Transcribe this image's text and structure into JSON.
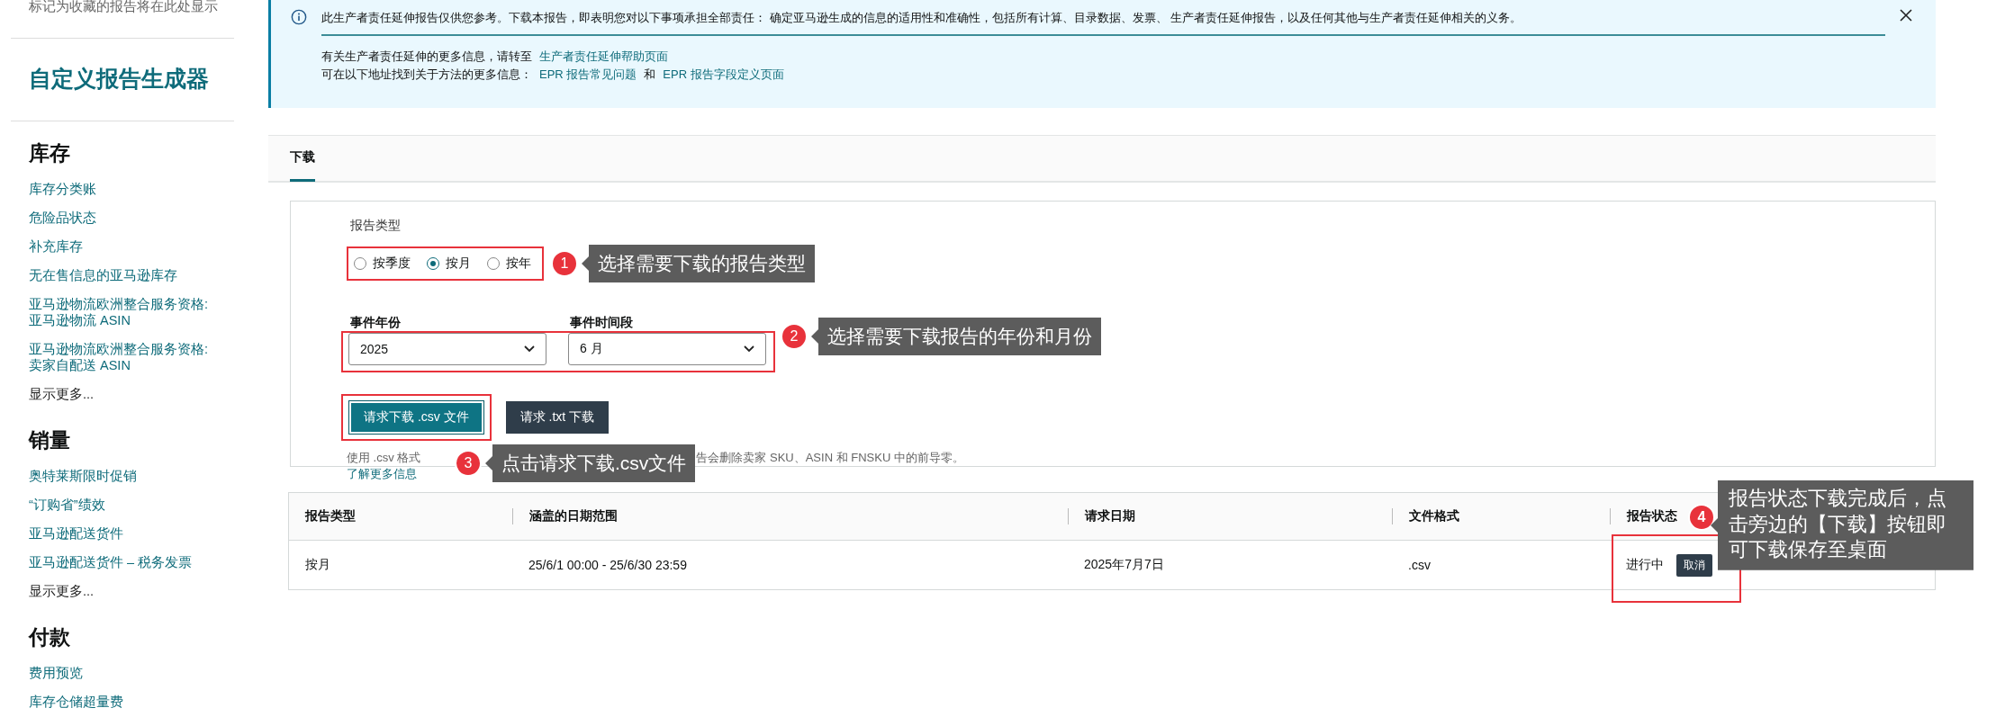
{
  "sidebar": {
    "favorites_note": "标记为收藏的报告将在此处显示",
    "title": "自定义报告生成器",
    "sections": [
      {
        "heading": "库存",
        "items": [
          "库存分类账",
          "危险品状态",
          "补充库存",
          "无在售信息的亚马逊库存",
          "亚马逊物流欧洲整合服务资格:\n亚马逊物流 ASIN",
          "亚马逊物流欧洲整合服务资格:\n卖家自配送 ASIN"
        ],
        "more": "显示更多..."
      },
      {
        "heading": "销量",
        "items": [
          "奥特莱斯限时促销",
          "“订购省”绩效",
          "亚马逊配送货件",
          "亚马逊配送货件 – 税务发票"
        ],
        "more": "显示更多..."
      },
      {
        "heading": "付款",
        "items": [
          "费用预览",
          "库存仓储超量费"
        ]
      }
    ]
  },
  "banner": {
    "message": "此生产者责任延伸报告仅供您参考。下载本报告，即表明您对以下事项承担全部责任： 确定亚马逊生成的信息的适用性和准确性，包括所有计算、目录数据、发票、 生产者责任延伸报告，以及任何其他与生产者责任延伸相关的义务。",
    "help_text": "有关生产者责任延伸的更多信息，请转至",
    "help_link": "生产者责任延伸帮助页面",
    "more_text": "可在以下地址找到关于方法的更多信息：",
    "links": [
      "EPR 报告常见问题",
      "EPR 报告字段定义页面"
    ],
    "joiner": "和"
  },
  "tabs": [
    {
      "label": "下载",
      "selected": true
    }
  ],
  "form": {
    "report_type_label": "报告类型",
    "report_types": [
      {
        "label": "按季度",
        "selected": false
      },
      {
        "label": "按月",
        "selected": true
      },
      {
        "label": "按年",
        "selected": false
      }
    ],
    "year_label": "事件年份",
    "year_value": "2025",
    "period_label": "事件时间段",
    "period_value": "6 月",
    "buttons": [
      {
        "label": "请求下载 .csv 文件",
        "kind": "primary"
      },
      {
        "label": "请求 .txt 下载",
        "kind": "secondary"
      }
    ],
    "note_parts": [
      "使用 .csv 格式",
      "告会删除卖家 SKU、ASIN 和 FNSKU 中的前导零。"
    ],
    "learn_more": "了解更多信息"
  },
  "table": {
    "columns": [
      "报告类型",
      "涵盖的日期范围",
      "请求日期",
      "文件格式",
      "报告状态"
    ],
    "rows": [
      {
        "cells": [
          "按月",
          "25/6/1 00:00 - 25/6/30 23:59",
          "2025年7月7日",
          ".csv"
        ],
        "status": "进行中",
        "action": "取消"
      }
    ]
  },
  "annotations": [
    {
      "number": "1",
      "text": "选择需要下载的报告类型"
    },
    {
      "number": "2",
      "text": "选择需要下载报告的年份和月份"
    },
    {
      "number": "3",
      "text": "点击请求下载.csv文件"
    },
    {
      "number": "4",
      "text": "报告状态下载完成后，点击旁边的【下载】按钮即可下载保存至桌面"
    }
  ]
}
